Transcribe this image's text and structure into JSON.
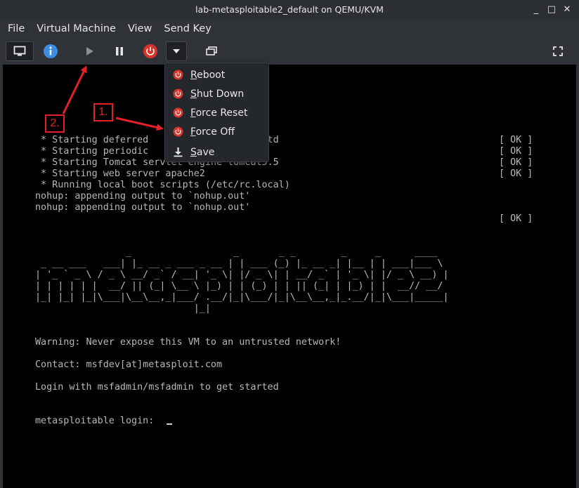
{
  "window": {
    "title": "lab-metasploitable2_default on QEMU/KVM",
    "controls": [
      "_",
      "□",
      "✕"
    ]
  },
  "menubar": {
    "items": [
      "File",
      "Virtual Machine",
      "View",
      "Send Key"
    ]
  },
  "toolbar": {
    "icons": [
      "monitor-icon",
      "info-icon",
      "play-icon",
      "pause-icon",
      "power-icon",
      "chevron-down-icon",
      "clone-icon",
      "fullscreen-icon"
    ],
    "colors": {
      "info": "#3d8ee0",
      "power": "#d9342b",
      "disabled": "#8a8d92"
    }
  },
  "dropdown": {
    "items": [
      {
        "label": "Reboot",
        "mnemonic": "R",
        "rest": "eboot",
        "icon": "power-icon"
      },
      {
        "label": "Shut Down",
        "mnemonic": "S",
        "rest": "hut Down",
        "icon": "power-icon"
      },
      {
        "label": "Force Reset",
        "mnemonic": "F",
        "rest": "orce Reset",
        "icon": "power-icon"
      },
      {
        "label": "Force Off",
        "mnemonic": "F",
        "rest": "orce Off",
        "icon": "power-icon"
      },
      {
        "label": "Save",
        "mnemonic": "S",
        "rest": "ave",
        "icon": "download-icon"
      }
    ]
  },
  "console": {
    "lines": [
      " * Starting deferred                ler atd",
      " * Starting periodic             r crond",
      " * Starting Tomcat servlet engine tomcat5.5",
      " * Starting web server apache2",
      " * Running local boot scripts (/etc/rc.local)",
      "nohup: appending output to `nohup.out'",
      "nohup: appending output to `nohup.out'",
      "",
      "",
      "",
      "                _                  _       _ _        _     _      ____",
      " _ __ ___   ___| |_ __ _ ___ _ __ | | ___ (_) |_ __ _| |__ | | ___|___ \\",
      "| '_ ` _ \\ / _ \\ __/ _` / __| '_ \\| |/ _ \\| | __/ _` | '_ \\| |/ _ \\ __) |",
      "| | | | | |  __/ || (_| \\__ \\ |_) | | (_) | | || (_| | |_) | |  __// __/",
      "|_| |_| |_|\\___|\\__\\__,_|___/ .__/|_|\\___/|_|\\__\\__,_|_.__/|_|\\___|_____|",
      "                            |_|",
      "",
      "",
      "Warning: Never expose this VM to an untrusted network!",
      "",
      "Contact: msfdev[at]metasploit.com",
      "",
      "Login with msfadmin/msfadmin to get started",
      "",
      "",
      "metasploitable login:  "
    ],
    "ok_lines": [
      "[ OK ]",
      "[ OK ]",
      "[ OK ]",
      "[ OK ]",
      "",
      "",
      "",
      "[ OK ]"
    ]
  },
  "annotations": [
    {
      "label": "1.",
      "color": "#e22126"
    },
    {
      "label": "2.",
      "color": "#e22126"
    }
  ]
}
